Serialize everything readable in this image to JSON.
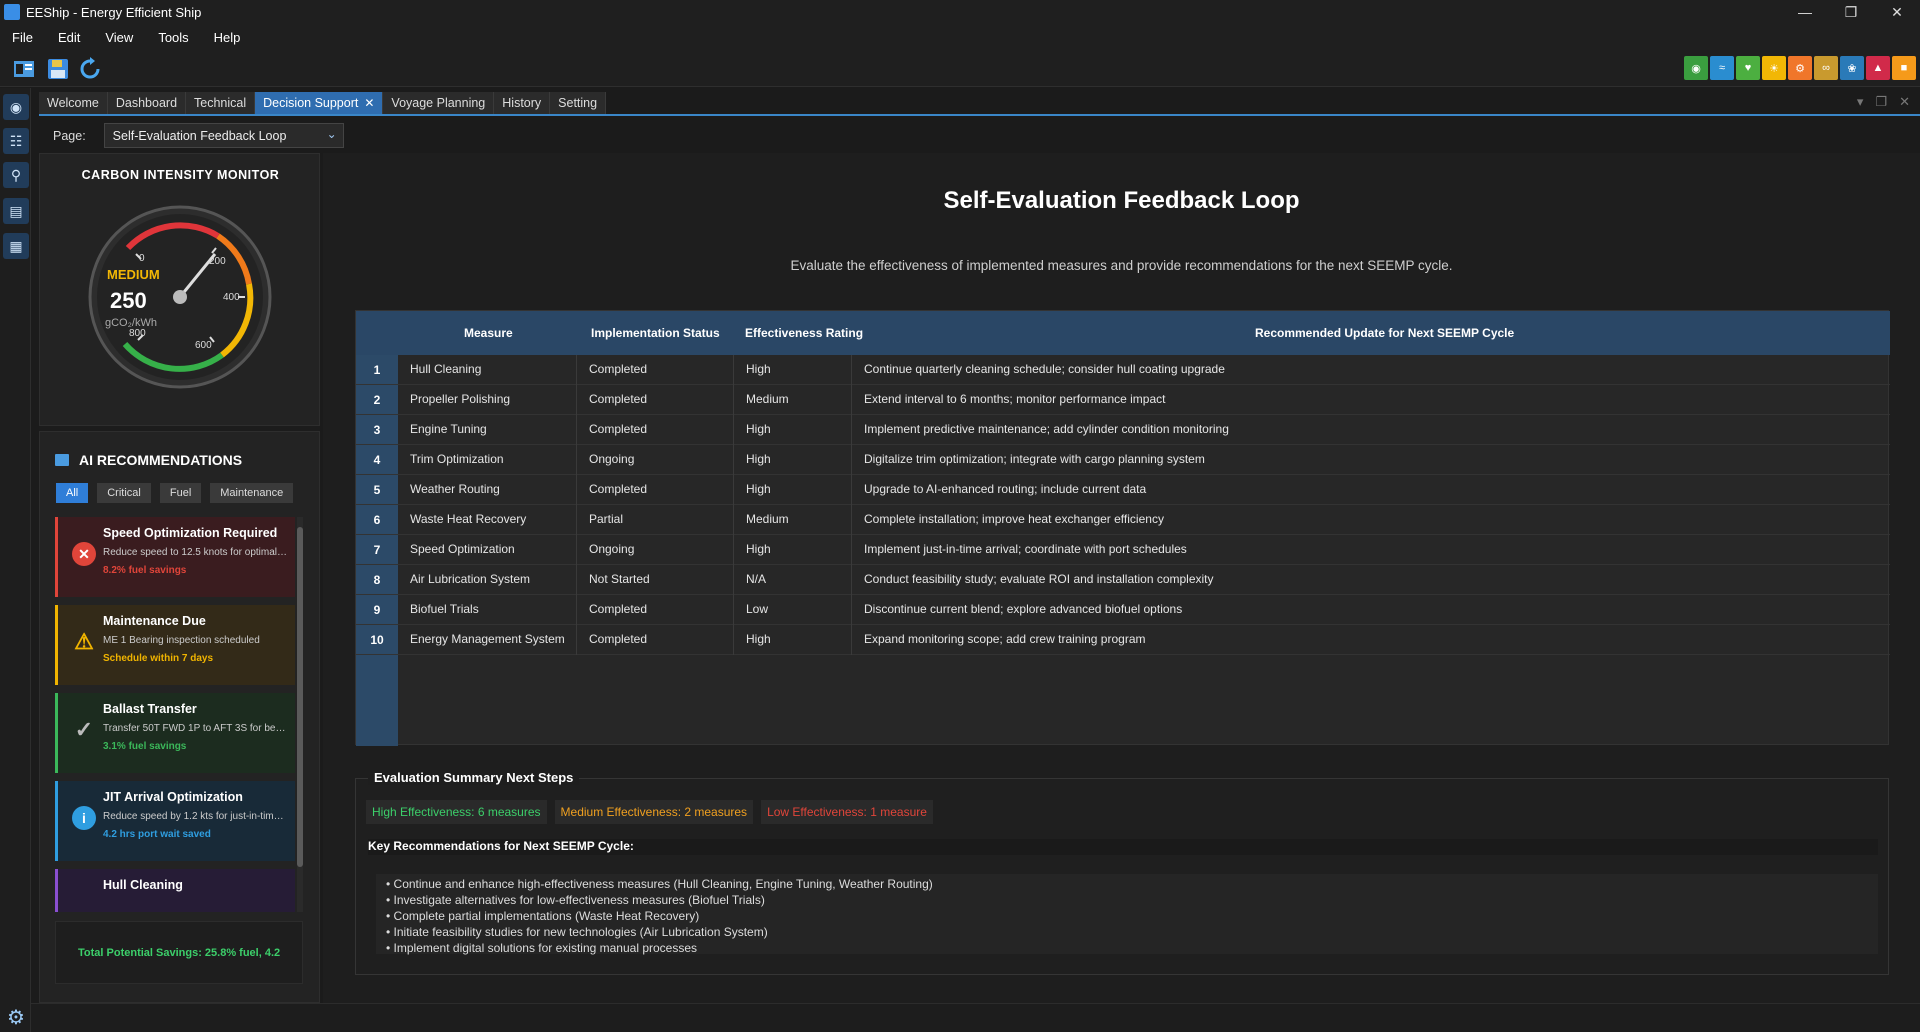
{
  "window": {
    "title": "EEShip - Energy Efficient Ship"
  },
  "menu": [
    "File",
    "Edit",
    "View",
    "Tools",
    "Help"
  ],
  "tabs": [
    {
      "label": "Welcome"
    },
    {
      "label": "Dashboard"
    },
    {
      "label": "Technical"
    },
    {
      "label": "Decision Support",
      "active": true
    },
    {
      "label": "Voyage Planning"
    },
    {
      "label": "History"
    },
    {
      "label": "Setting"
    }
  ],
  "page_selector": {
    "label": "Page:",
    "value": "Self-Evaluation Feedback Loop"
  },
  "gauge": {
    "title": "CARBON INTENSITY MONITOR",
    "status": "MEDIUM",
    "value": "250",
    "unit": "gCO₂/kWh",
    "ticks": [
      "0",
      "200",
      "400",
      "600",
      "800"
    ]
  },
  "ai": {
    "title": "AI RECOMMENDATIONS",
    "filters": [
      "All",
      "Critical",
      "Fuel",
      "Maintenance"
    ],
    "cards": [
      {
        "title": "Speed Optimization Required",
        "desc": "Reduce speed to 12.5 knots for optimal ...",
        "stat": "8.2% fuel savings",
        "icon": "close-icon",
        "color": "#e0453a"
      },
      {
        "title": "Maintenance Due",
        "desc": "ME 1 Bearing inspection scheduled",
        "stat": "Schedule within 7 days",
        "icon": "warning-icon",
        "color": "#f0b400"
      },
      {
        "title": "Ballast Transfer",
        "desc": "Transfer 50T FWD 1P to AFT 3S for bette...",
        "stat": "3.1% fuel savings",
        "icon": "check-icon",
        "color": "#3bb85a"
      },
      {
        "title": "JIT Arrival Optimization",
        "desc": "Reduce speed by 1.2 kts for just-in-time...",
        "stat": "4.2 hrs port wait saved",
        "icon": "info-icon",
        "color": "#2f9ee0"
      },
      {
        "title": "Hull Cleaning",
        "desc": "",
        "stat": "",
        "icon": "",
        "color": "#8a4fd0"
      }
    ],
    "total": "Total Potential Savings: 25.8% fuel, 4.2"
  },
  "main": {
    "title": "Self-Evaluation Feedback Loop",
    "subtitle": "Evaluate the effectiveness of implemented measures and provide recommendations for the next SEEMP cycle.",
    "columns": [
      "Measure",
      "Implementation Status",
      "Effectiveness Rating",
      "Recommended Update for Next SEEMP Cycle"
    ],
    "rows": [
      [
        "1",
        "Hull Cleaning",
        "Completed",
        "High",
        "Continue quarterly cleaning schedule; consider hull coating upgrade"
      ],
      [
        "2",
        "Propeller Polishing",
        "Completed",
        "Medium",
        "Extend interval to 6 months; monitor performance impact"
      ],
      [
        "3",
        "Engine Tuning",
        "Completed",
        "High",
        "Implement predictive maintenance; add cylinder condition monitoring"
      ],
      [
        "4",
        "Trim Optimization",
        "Ongoing",
        "High",
        "Digitalize trim optimization; integrate with cargo planning system"
      ],
      [
        "5",
        "Weather Routing",
        "Completed",
        "High",
        "Upgrade to AI-enhanced routing; include current data"
      ],
      [
        "6",
        "Waste Heat Recovery",
        "Partial",
        "Medium",
        "Complete installation; improve heat exchanger efficiency"
      ],
      [
        "7",
        "Speed Optimization",
        "Ongoing",
        "High",
        "Implement just-in-time arrival; coordinate with port schedules"
      ],
      [
        "8",
        "Air Lubrication System",
        "Not Started",
        "N/A",
        "Conduct feasibility study; evaluate ROI and installation complexity"
      ],
      [
        "9",
        "Biofuel Trials",
        "Completed",
        "Low",
        "Discontinue current blend; explore advanced biofuel options"
      ],
      [
        "10",
        "Energy Management System",
        "Completed",
        "High",
        "Expand monitoring scope; add crew training program"
      ]
    ]
  },
  "summary": {
    "legend": "Evaluation Summary  Next Steps",
    "chips": [
      {
        "text": "High Effectiveness: 6 measures",
        "color": "#3ccf6a"
      },
      {
        "text": "Medium Effectiveness: 2 measures",
        "color": "#f0a020"
      },
      {
        "text": "Low Effectiveness: 1 measure",
        "color": "#e0453a"
      }
    ],
    "key_title": "Key Recommendations for Next SEEMP Cycle:",
    "key_items": [
      "• Continue and enhance high-effectiveness measures (Hull Cleaning, Engine Tuning, Weather Routing)",
      "• Investigate alternatives for low-effectiveness measures (Biofuel Trials)",
      "• Complete partial implementations (Waste Heat Recovery)",
      "• Initiate feasibility studies for new technologies (Air Lubrication System)",
      "• Implement digital solutions for existing manual processes"
    ]
  }
}
